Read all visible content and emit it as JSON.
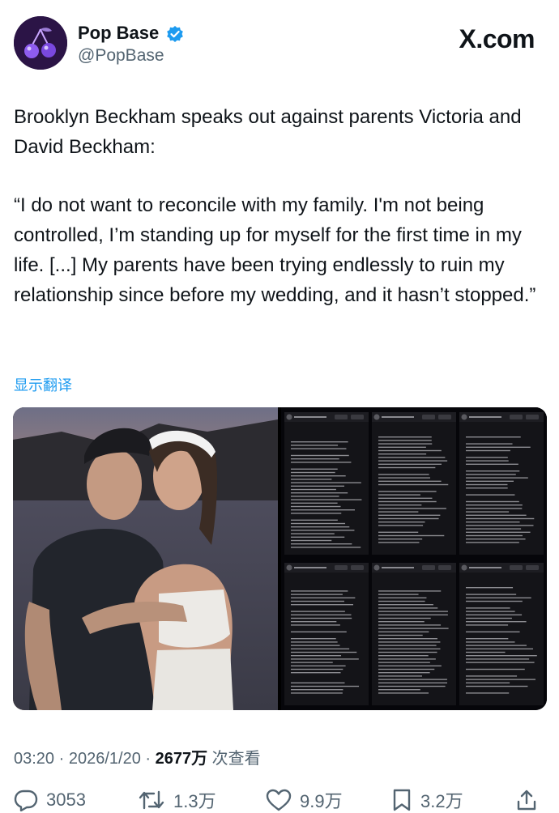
{
  "header": {
    "display_name": "Pop Base",
    "handle": "@PopBase",
    "site_watermark": "X.com",
    "verified_icon": "verified-badge-icon",
    "avatar_icon": "cherry-avatar-icon"
  },
  "post": {
    "paragraph_1": "Brooklyn Beckham speaks out against parents Victoria and David Beckham:",
    "paragraph_2": "“I do not want to reconcile with my family. I'm not being controlled, I’m standing up for myself for the first time in my life. [...] My parents have been trying endlessly to ruin my relationship since before my wedding, and it hasn’t stopped.”",
    "translate_label": "显示翻译"
  },
  "meta": {
    "time": "03:20",
    "date": "2026/1/20",
    "views": "2677万",
    "views_label": "次查看"
  },
  "actions": {
    "replies": "3053",
    "reposts": "1.3万",
    "likes": "9.9万",
    "bookmarks": "3.2万"
  },
  "colors": {
    "accent": "#1d9bf0",
    "text": "#0f1419",
    "secondary": "#536471"
  }
}
